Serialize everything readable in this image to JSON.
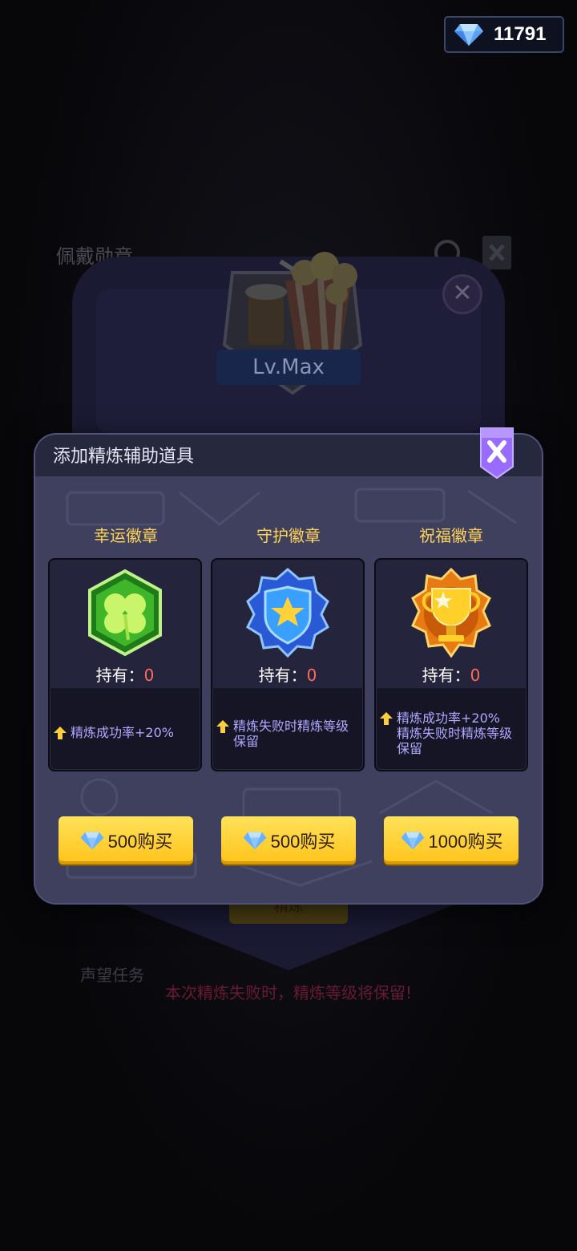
{
  "currency": {
    "icon": "diamond-icon",
    "amount": "11791"
  },
  "background": {
    "title": "佩戴勋章",
    "badge_level": "Lv.Max",
    "subtitle": "",
    "button_label": "精炼",
    "bottom_tabs": [
      "声望任务",
      "",
      ""
    ],
    "warning": "本次精炼失败时，精炼等级将保留!"
  },
  "modal": {
    "title": "添加精炼辅助道具",
    "close_icon": "close-icon",
    "items": [
      {
        "name": "幸运徽章",
        "icon": "clover-badge-icon",
        "hold_label": "持有：",
        "hold_count": "0",
        "desc": [
          "精炼成功率+20%"
        ],
        "price": "500购买"
      },
      {
        "name": "守护徽章",
        "icon": "shield-star-badge-icon",
        "hold_label": "持有：",
        "hold_count": "0",
        "desc": [
          "精炼失败时精炼等级",
          "保留"
        ],
        "price": "500购买"
      },
      {
        "name": "祝福徽章",
        "icon": "trophy-badge-icon",
        "hold_label": "持有：",
        "hold_count": "0",
        "desc": [
          "精炼成功率+20%",
          "精炼失败时精炼等级",
          "保留"
        ],
        "price": "1000购买"
      }
    ]
  },
  "colors": {
    "accent_gold": "#ffd35a",
    "count_red": "#ff6a5a",
    "desc_purple": "#b0a8ff",
    "warning_red": "#6a1a30"
  }
}
